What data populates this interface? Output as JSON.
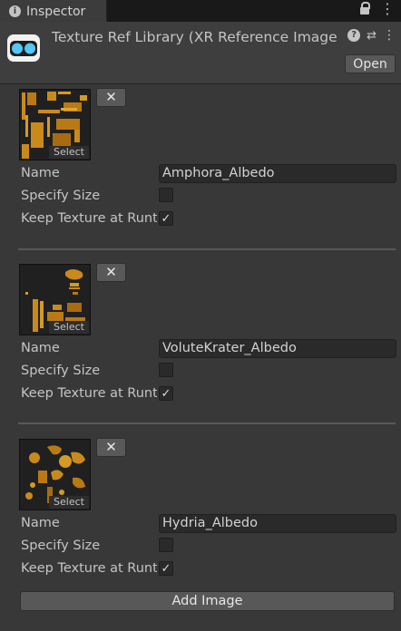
{
  "tab": {
    "title": "Inspector",
    "icon": "info-icon",
    "lock_icon": "lock-icon",
    "menu_icon": "kebab-menu-icon"
  },
  "header": {
    "title": "Texture Ref Library (XR Reference Image",
    "asset_icon": "xr-reference-library-icon",
    "icons": [
      "help-icon",
      "preset-icon",
      "more-menu-icon"
    ],
    "open_label": "Open"
  },
  "entries": [
    {
      "name": "Amphora_Albedo",
      "select_label": "Select",
      "remove_label": "✕",
      "name_label": "Name",
      "specify_size_label": "Specify Size",
      "specify_size": false,
      "keep_texture_label": "Keep Texture at Runt",
      "keep_texture": true,
      "check_glyph": "✓"
    },
    {
      "name": "VoluteKrater_Albedo",
      "select_label": "Select",
      "remove_label": "✕",
      "name_label": "Name",
      "specify_size_label": "Specify Size",
      "specify_size": false,
      "keep_texture_label": "Keep Texture at Runt",
      "keep_texture": true,
      "check_glyph": "✓"
    },
    {
      "name": "Hydria_Albedo",
      "select_label": "Select",
      "remove_label": "✕",
      "name_label": "Name",
      "specify_size_label": "Specify Size",
      "specify_size": false,
      "keep_texture_label": "Keep Texture at Runt",
      "keep_texture": true,
      "check_glyph": "✓"
    }
  ],
  "add_image_label": "Add Image",
  "colors": {
    "background": "#383838",
    "texture_orange": "#c98a1b",
    "field": "#2a2a2a"
  }
}
